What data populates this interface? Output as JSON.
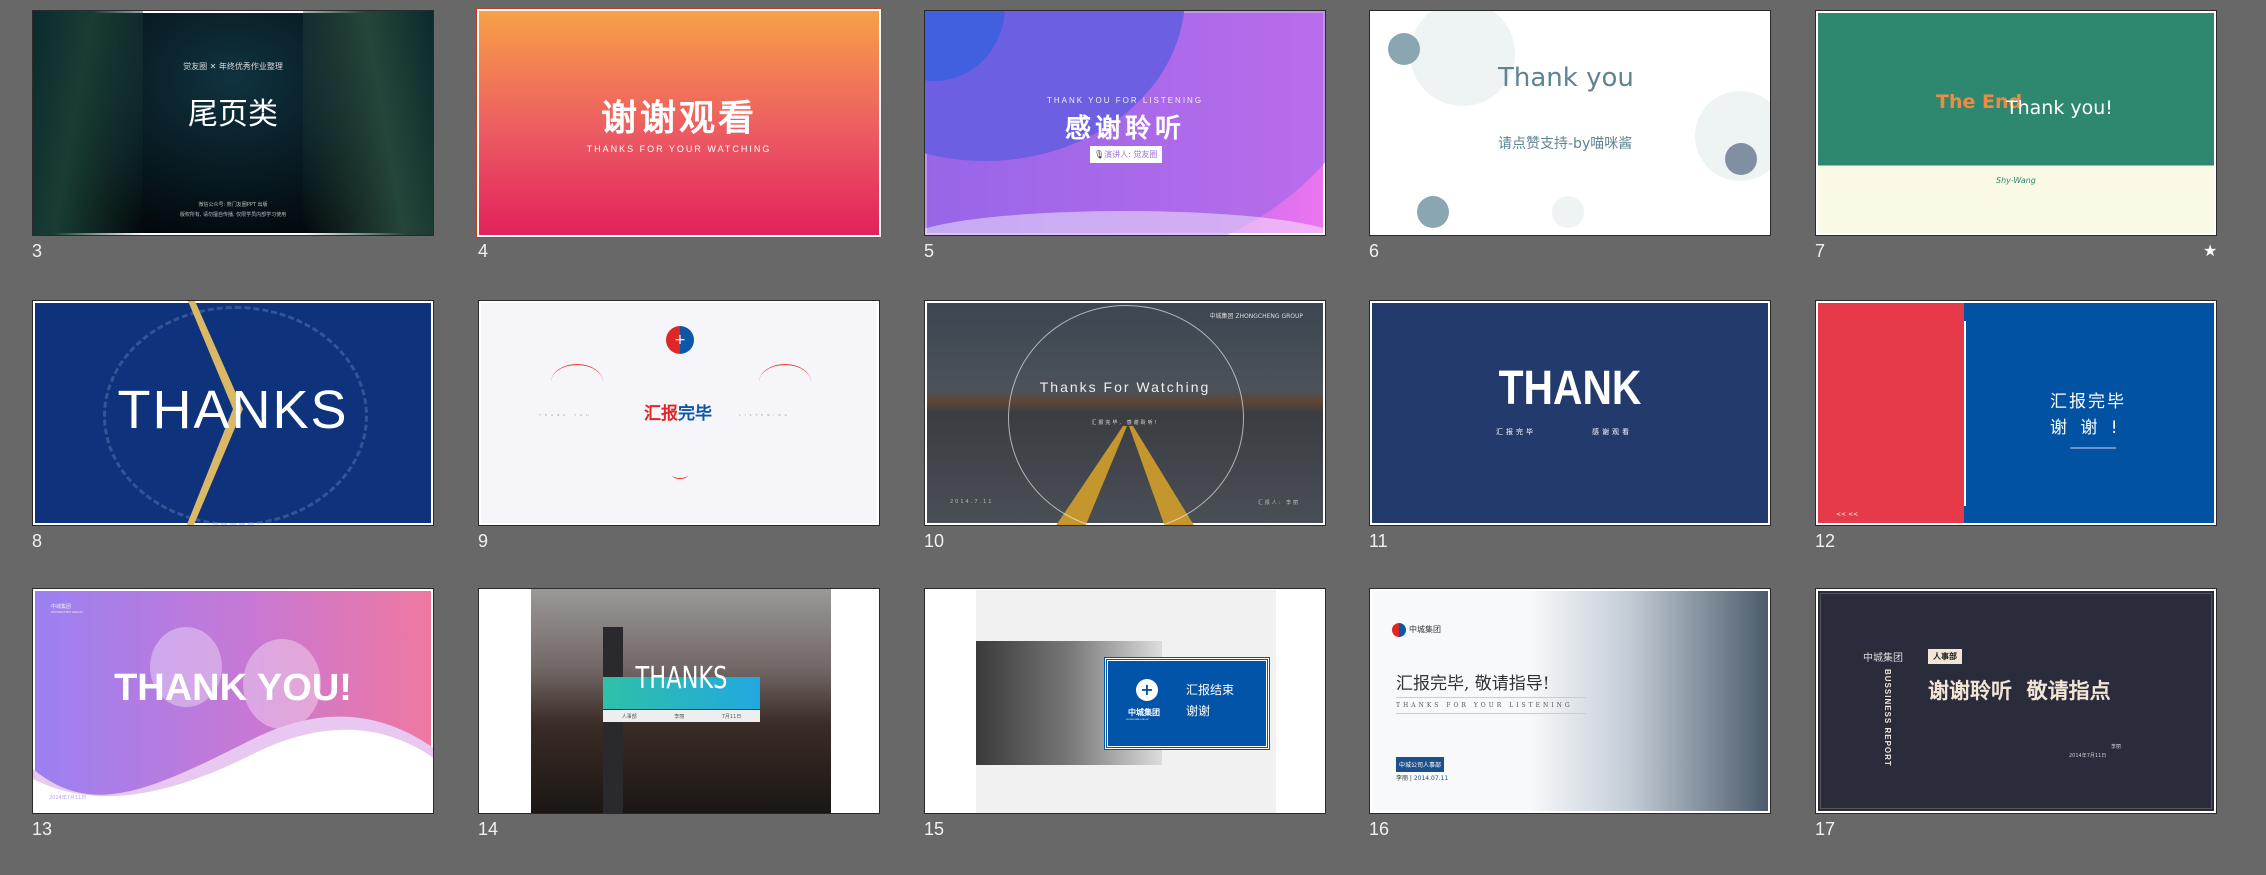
{
  "selected_slide": "4",
  "colors": {
    "background": "#686868",
    "selection_border": "#c0401e"
  },
  "slides": [
    {
      "number": "3",
      "top": "觉友圈 ✕ 年终优秀作业整理",
      "title": "尾页类",
      "line1": "微信公众号: 熊门友圈PPT 出版",
      "line2": "版权所有, 请勿擅自传播, 仅限学员内部学习使用"
    },
    {
      "number": "4",
      "title": "谢谢观看",
      "subtitle": "THANKS FOR YOUR WATCHING"
    },
    {
      "number": "5",
      "subtitle": "THANK YOU FOR LISTENING",
      "title": "感谢聆听",
      "speaker": "演讲人: 觉友圈",
      "mic_icon": "microphone-icon"
    },
    {
      "number": "6",
      "title": "Thank you",
      "subtitle": "请点赞支持-by喵咪酱"
    },
    {
      "number": "7",
      "title_a": "The End",
      "title_b": "Thank you!",
      "signature": "Shy-Wang",
      "star_icon": "star-icon"
    },
    {
      "number": "8",
      "title": "THANKS"
    },
    {
      "number": "9",
      "title_a": "汇报",
      "title_b": "完毕",
      "left_text": "THANK YOU",
      "right_text": "LISTENING"
    },
    {
      "number": "10",
      "brand": "中城集团 ZHONGCHENG GROUP",
      "title": "Thanks For Watching",
      "subtitle": "汇报完毕, 感谢聆听!",
      "date": "2014.7.11",
      "reporter": "汇报人: 李丽"
    },
    {
      "number": "11",
      "title": "THANK",
      "sub_left": "汇报完毕",
      "sub_right": "感谢观看"
    },
    {
      "number": "12",
      "line1": "汇报完毕",
      "line2": "谢 谢 !",
      "arrows": "<< <<"
    },
    {
      "number": "13",
      "brand": "中城集团",
      "brand_en": "ZHONGCHEN GROUP",
      "title": "THANK YOU!",
      "date": "2014年7月11日"
    },
    {
      "number": "14",
      "title": "THANKS",
      "dept": "人事部",
      "name": "李丽",
      "date": "7月11日"
    },
    {
      "number": "15",
      "logo_text": "中城集团",
      "logo_en": "ZHONGCHENG GROUP",
      "line1": "汇报结束",
      "line2": "谢谢"
    },
    {
      "number": "16",
      "brand": "中城集团",
      "title": "汇报完毕, 敬请指导!",
      "subtitle": "THANKS FOR YOUR LISTENING",
      "dept": "中城公司人事部",
      "name": "李丽",
      "date": "2014.07.11"
    },
    {
      "number": "17",
      "brand": "中城集团",
      "dept": "人事部",
      "vertical": "BUSSINESS REPORT",
      "title": "谢谢聆听  敬请指点",
      "name": "李丽",
      "date": "2014年7月11日"
    }
  ]
}
